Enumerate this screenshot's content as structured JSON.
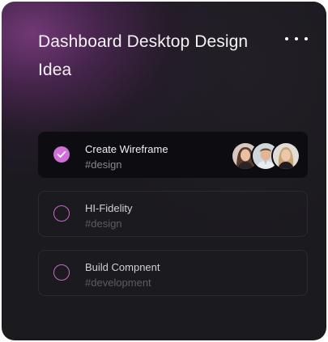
{
  "card": {
    "title": "Dashboard Desktop Design Idea",
    "menu_icon": "more-horizontal-icon"
  },
  "tasks": [
    {
      "name": "Create Wireframe",
      "tag": "#design",
      "completed": true,
      "assignees": 3
    },
    {
      "name": "HI-Fidelity",
      "tag": "#design",
      "completed": false
    },
    {
      "name": "Build Compnent",
      "tag": "#development",
      "completed": false
    }
  ],
  "colors": {
    "accent": "#d36fd8",
    "card_bg": "#1b1a1f",
    "glow": "#763a7a",
    "active_row": "#0d0c10"
  }
}
